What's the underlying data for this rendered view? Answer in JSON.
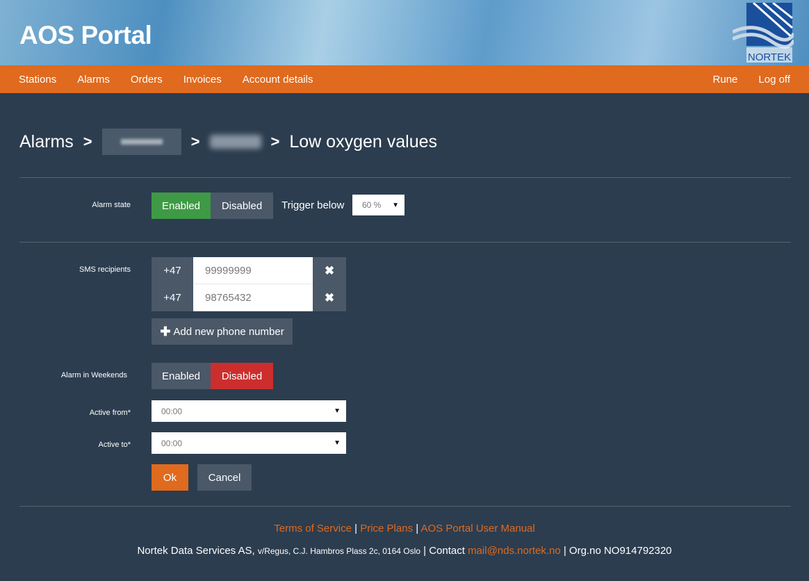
{
  "header": {
    "title": "AOS Portal",
    "logo_text": "NORTEK"
  },
  "nav": {
    "items": [
      "Stations",
      "Alarms",
      "Orders",
      "Invoices",
      "Account details"
    ],
    "user": "Rune",
    "logoff": "Log off"
  },
  "breadcrumb": {
    "root": "Alarms",
    "current": "Low oxygen values",
    "separator": ">"
  },
  "alarm_state": {
    "label": "Alarm state",
    "enabled": "Enabled",
    "disabled": "Disabled",
    "selected": "Enabled",
    "trigger_label": "Trigger below",
    "trigger_value": "60 %"
  },
  "sms": {
    "label": "SMS recipients",
    "recipients": [
      {
        "cc": "+47",
        "number": "99999999"
      },
      {
        "cc": "+47",
        "number": "98765432"
      }
    ],
    "remove_icon": "✖",
    "add_label": "Add new phone number"
  },
  "weekends": {
    "label": "Alarm in Weekends",
    "enabled": "Enabled",
    "disabled": "Disabled",
    "selected": "Disabled"
  },
  "active_from": {
    "label": "Active from*",
    "value": "00:00"
  },
  "active_to": {
    "label": "Active to*",
    "value": "00:00"
  },
  "actions": {
    "ok": "Ok",
    "cancel": "Cancel"
  },
  "footer": {
    "terms": "Terms of Service",
    "pricing": "Price Plans",
    "manual": "AOS Portal User Manual",
    "pipe": "|",
    "company": "Nortek Data Services AS,",
    "address": "v/Regus, C.J. Hambros Plass 2c, 0164 Oslo",
    "contact_label": "| Contact",
    "email": "mail@nds.nortek.no",
    "org": "| Org.no NO914792320"
  },
  "colors": {
    "background": "#2c3d4f",
    "accent": "#e06a1e",
    "enabled": "#3f9a45",
    "disabled": "#cc2e2e",
    "neutral": "#4a5868"
  }
}
